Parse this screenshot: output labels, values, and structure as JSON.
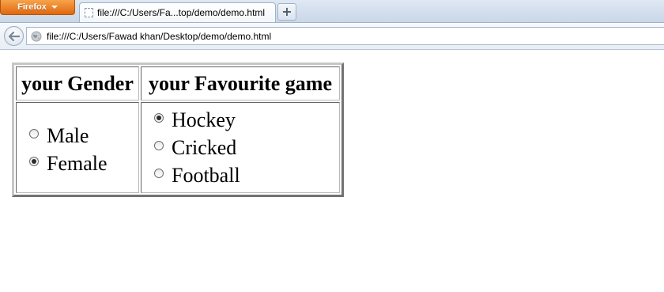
{
  "browser": {
    "menu_label": "Firefox",
    "tab_title": "file:///C:/Users/Fa...top/demo/demo.html",
    "new_tab_label": "+",
    "address": "file:///C:/Users/Fawad khan/Desktop/demo/demo.html"
  },
  "page": {
    "headers": [
      "your Gender",
      "your Favourite game"
    ],
    "gender": {
      "options": [
        {
          "label": "Male",
          "checked": false
        },
        {
          "label": "Female",
          "checked": true
        }
      ]
    },
    "game": {
      "options": [
        {
          "label": "Hockey",
          "checked": true
        },
        {
          "label": "Cricked",
          "checked": false
        },
        {
          "label": "Football",
          "checked": false
        }
      ]
    }
  }
}
